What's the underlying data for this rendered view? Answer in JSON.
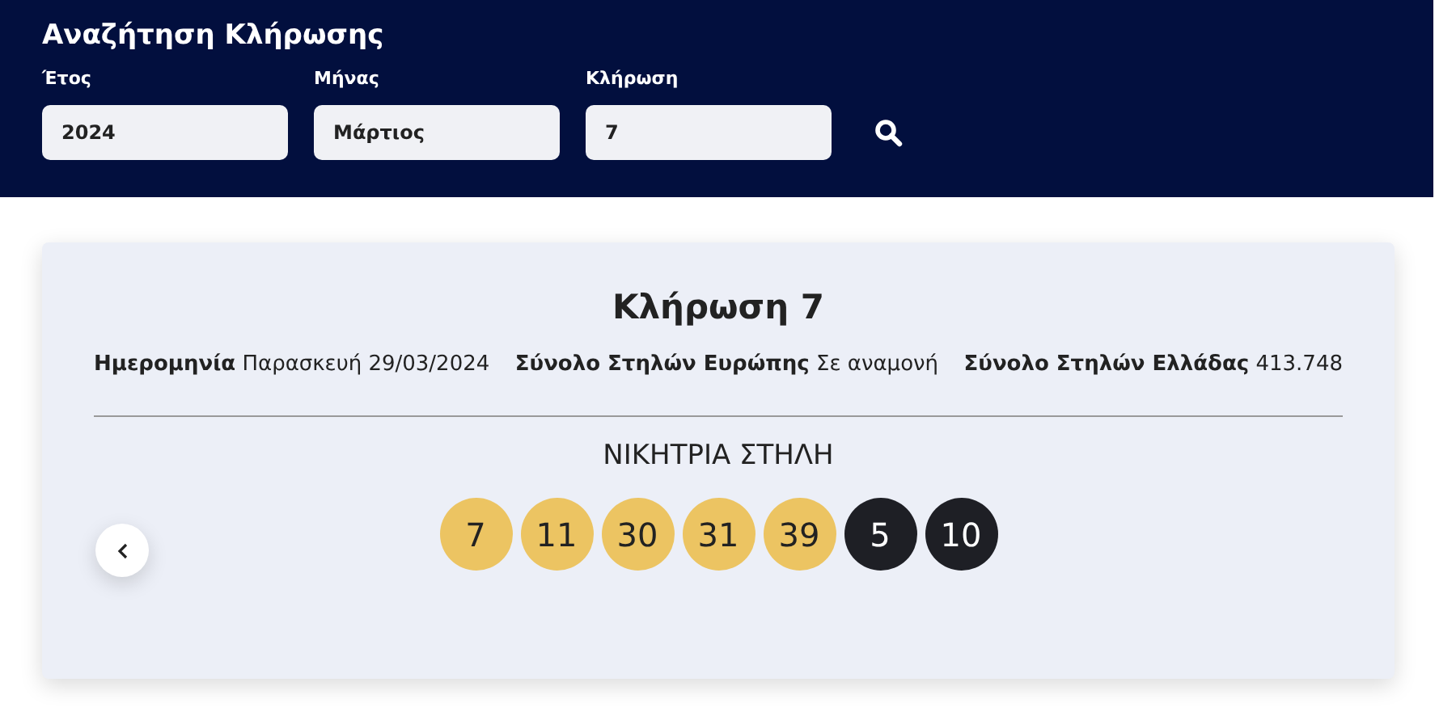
{
  "search": {
    "title": "Αναζήτηση Κλήρωσης",
    "fields": [
      {
        "label": "Έτος",
        "value": "2024"
      },
      {
        "label": "Μήνας",
        "value": "Μάρτιος"
      },
      {
        "label": "Κλήρωση",
        "value": "7"
      }
    ]
  },
  "draw": {
    "title": "Κλήρωση 7",
    "info": [
      {
        "label": "Ημερομηνία",
        "value": "Παρασκευή 29/03/2024"
      },
      {
        "label": "Σύνολο Στηλών Ευρώπης",
        "value": "Σε αναμονή"
      },
      {
        "label": "Σύνολο Στηλών Ελλάδας",
        "value": "413.748"
      }
    ],
    "winning_title": "ΝΙΚΗΤΡΙΑ ΣΤΗΛΗ",
    "balls": [
      {
        "number": "7",
        "kind": "main"
      },
      {
        "number": "11",
        "kind": "main"
      },
      {
        "number": "30",
        "kind": "main"
      },
      {
        "number": "31",
        "kind": "main"
      },
      {
        "number": "39",
        "kind": "main"
      },
      {
        "number": "5",
        "kind": "bonus"
      },
      {
        "number": "10",
        "kind": "bonus"
      }
    ]
  }
}
